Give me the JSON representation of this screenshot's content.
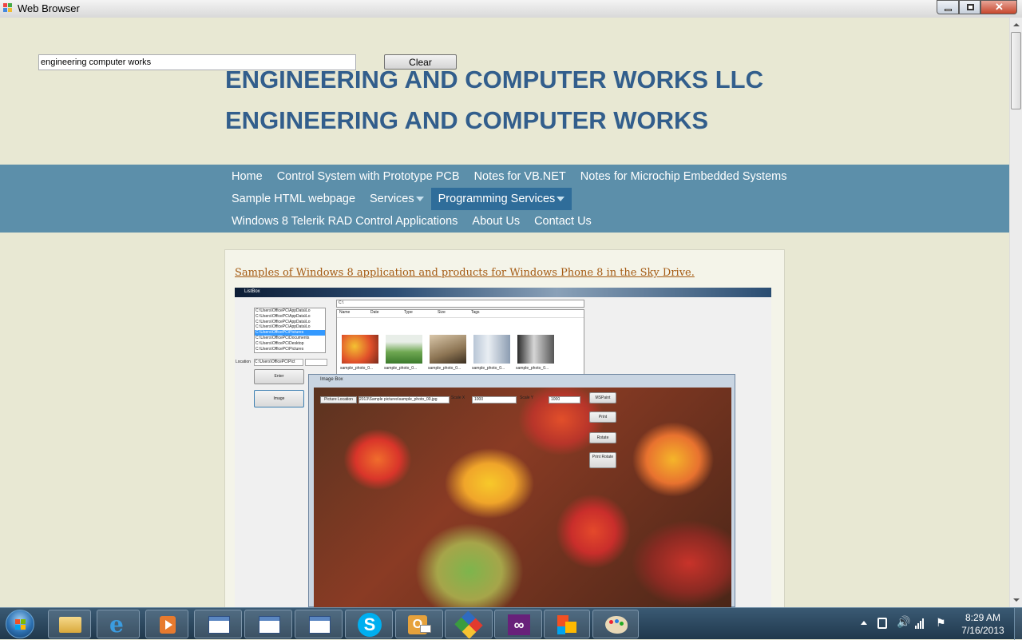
{
  "window": {
    "title": "Web Browser"
  },
  "search": {
    "value": "engineering computer works",
    "clear_label": "Clear"
  },
  "site": {
    "title1": "ENGINEERING AND COMPUTER WORKS LLC",
    "title2": "ENGINEERING AND COMPUTER WORKS"
  },
  "nav": {
    "row1": [
      "Home",
      "Control System with Prototype PCB",
      "Notes for VB.NET",
      "Notes for Microchip Embedded Systems"
    ],
    "row2": [
      "Sample HTML webpage",
      "Services",
      "Programming Services"
    ],
    "row3": [
      "Windows 8 Telerik RAD Control Applications",
      "About Us",
      "Contact Us"
    ],
    "active": "Programming Services"
  },
  "content": {
    "link_text": "Samples of Windows 8 application and products for Windows Phone 8 in the Sky Drive."
  },
  "screenshot": {
    "window_title": "ListBox",
    "listbox_items": [
      "C:\\Users\\OfficePC\\AppData\\Lo",
      "C:\\Users\\OfficePC\\AppData\\Lo",
      "C:\\Users\\OfficePC\\AppData\\Lo",
      "C:\\Users\\OfficePC\\AppData\\Lo",
      "C:\\Users\\OfficePC\\Pictures",
      "C:\\Users\\OfficePC\\Documents",
      "C:\\Users\\OfficePC\\Desktop",
      "C:\\Users\\OfficePC\\Pictures"
    ],
    "location_label": "Location",
    "location_value": "C:\\Users\\OfficePC\\Pict",
    "enter_label": "Enter",
    "image_label": "Image",
    "path_value": "C:\\",
    "columns": [
      "Name",
      "Date",
      "Type",
      "Size",
      "Tags"
    ],
    "thumb_labels": [
      "sample_photo_0...",
      "sample_photo_0...",
      "sample_photo_0...",
      "sample_photo_0...",
      "sample_photo_0..."
    ],
    "imagebox_title": "Image Box",
    "picture_location_label": "Picture Location",
    "picture_location_value": "2013\\Sample pictures\\sample_photo_00.jpg",
    "scale_x_label": "Scale X",
    "scale_x_value": "1000",
    "scale_y_label": "Scale Y",
    "scale_y_value": "1000",
    "buttons": [
      "MSPaint",
      "Print",
      "Rotate",
      "Print Rotate"
    ]
  },
  "taskbar": {
    "time": "8:29 AM",
    "date": "7/16/2013",
    "apps": [
      "start-orb-icon",
      "file-explorer-icon",
      "internet-explorer-icon",
      "media-player-icon",
      "window-icon",
      "window-icon",
      "window-icon",
      "skype-icon",
      "outlook-icon",
      "app-icon",
      "visual-studio-icon",
      "office-icon",
      "paint-icon"
    ]
  }
}
